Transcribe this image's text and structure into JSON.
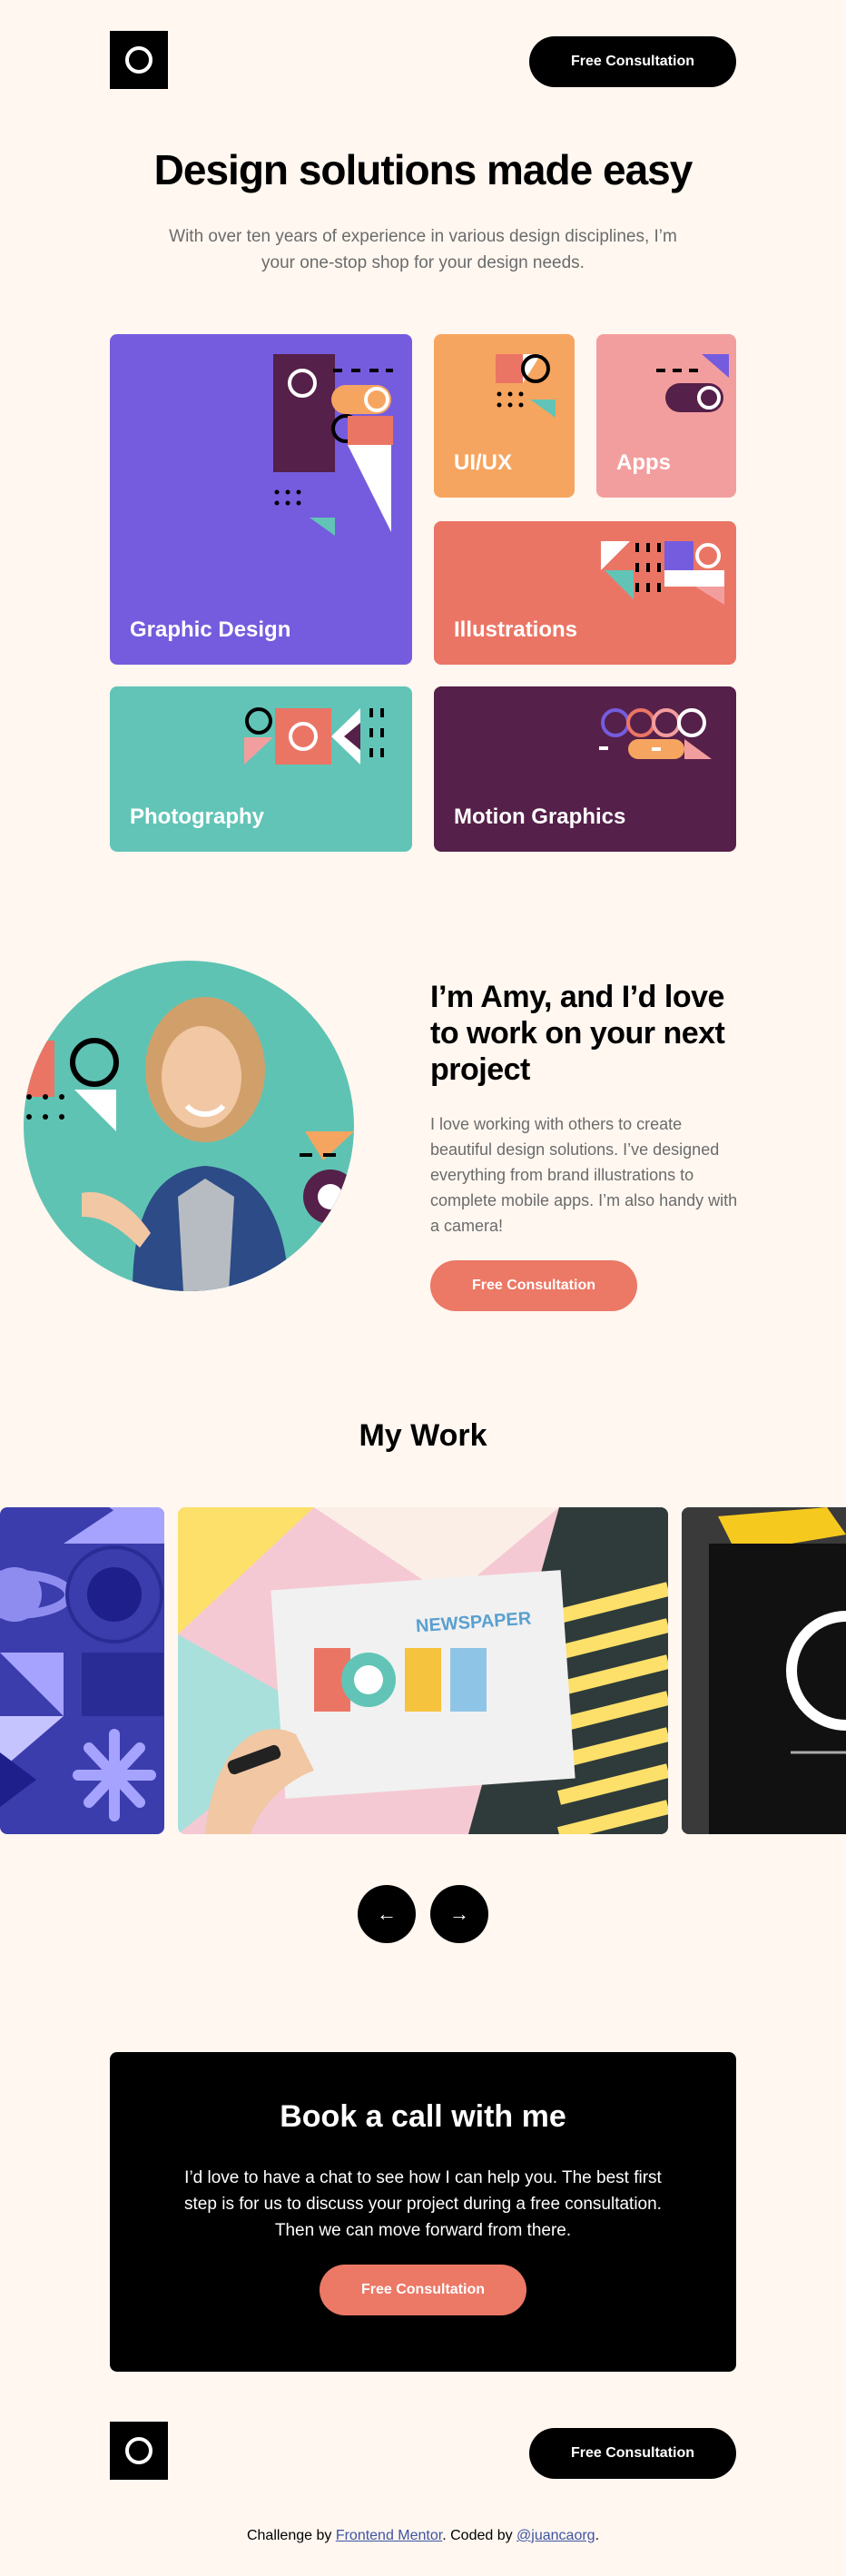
{
  "header": {
    "cta_label": "Free Consultation"
  },
  "hero": {
    "title": "Design solutions made easy",
    "subtitle": "With over ten years of experience in various design disciplines, I’m your one-stop shop for your design needs."
  },
  "services": [
    {
      "label": "Graphic Design",
      "color": "#755cde"
    },
    {
      "label": "UI/UX",
      "color": "#f6a560"
    },
    {
      "label": "Apps",
      "color": "#f39e9e"
    },
    {
      "label": "Illustrations",
      "color": "#eb7565"
    },
    {
      "label": "Photography",
      "color": "#61c4b7"
    },
    {
      "label": "Motion Graphics",
      "color": "#552049"
    }
  ],
  "about": {
    "title": "I’m Amy, and I’d love to work on your next project",
    "text": "I love working with others to create beautiful design solutions. I’ve designed everything from brand illustrations to complete mobile apps. I’m also handy with a camera!",
    "cta_label": "Free Consultation"
  },
  "work": {
    "title": "My Work",
    "newspaper_label": "NEWSPAPER",
    "prev_icon": "arrow-left-icon",
    "next_icon": "arrow-right-icon"
  },
  "cta": {
    "title": "Book a call with me",
    "text": "I’d love to have a chat to see how I can help you. The best first step is for us to discuss your project during a free consultation. Then we can move forward from there.",
    "button_label": "Free Consultation"
  },
  "footer": {
    "cta_label": "Free Consultation",
    "attribution_prefix": "Challenge by ",
    "attribution_link1": "Frontend Mentor",
    "attribution_mid": ". Coded by ",
    "attribution_link2": "@juancaorg",
    "attribution_suffix": "."
  },
  "colors": {
    "background": "#fff7f0",
    "coral": "#ec7866",
    "black": "#000000"
  }
}
